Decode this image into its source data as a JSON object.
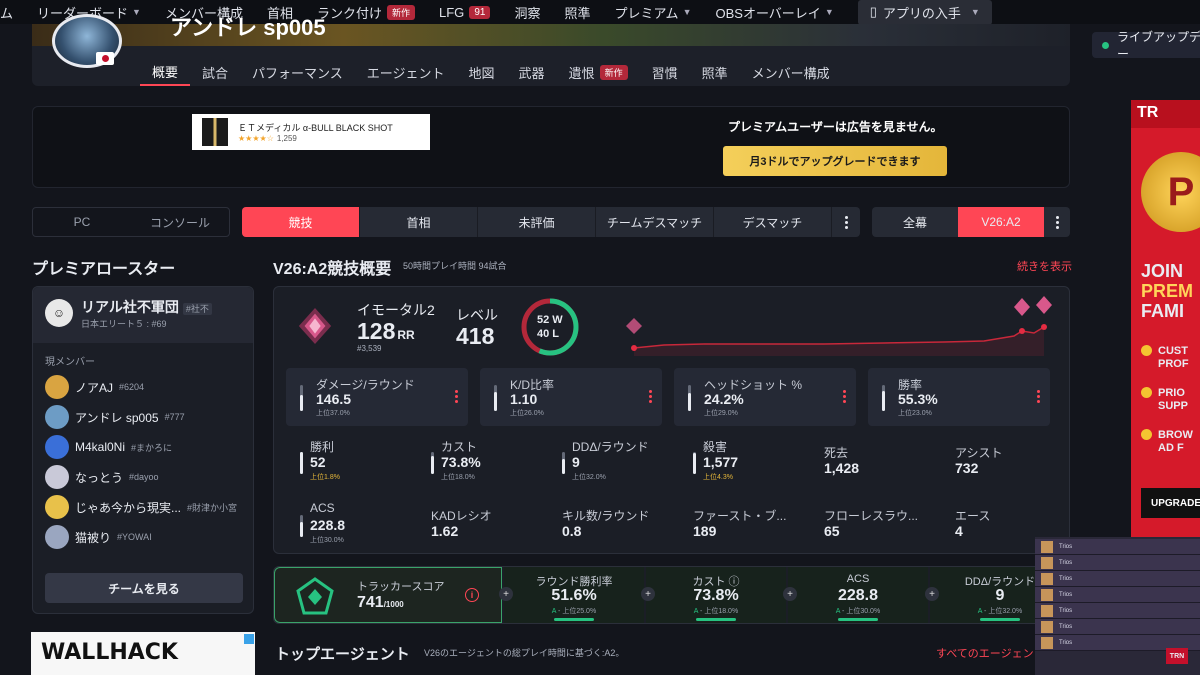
{
  "topnav": {
    "items": [
      {
        "label": "ム"
      },
      {
        "label": "リーダーボード",
        "chevron": true
      },
      {
        "label": "メンバー構成"
      },
      {
        "label": "首相"
      },
      {
        "label": "ランク付け",
        "badge": "新作"
      },
      {
        "label": "LFG",
        "count": "91"
      },
      {
        "label": "洞察"
      },
      {
        "label": "照準"
      },
      {
        "label": "プレミアム",
        "chevron": true
      },
      {
        "label": "OBSオーバーレイ"
      }
    ],
    "app_button": "アプリの入手"
  },
  "profile": {
    "name": "アンドレ sp005",
    "tabs": [
      "概要",
      "試合",
      "パフォーマンス",
      "エージェント",
      "地図",
      "武器",
      "遺恨",
      "習慣",
      "照準",
      "メンバー構成"
    ],
    "tab_badge": "新作",
    "active_tab": "概要"
  },
  "live_pill": "ライブアップデー",
  "ads": {
    "product": "ＥＴメディカル α-BULL BLACK SHOT",
    "reviews": "1,259",
    "premium_text": "プレミアムユーザーは広告を見ません。",
    "upgrade_button": "月3ドルでアップグレードできます",
    "right_top": "TR",
    "right_coin": "P",
    "right_headline": [
      "JOIN",
      "PREM",
      "FAMI"
    ],
    "right_list": [
      "CUST",
      "PROF",
      "PRIO",
      "SUPP",
      "BROW",
      "AD F"
    ],
    "right_button": "UPGRADE",
    "wallhack": "WALLHACK"
  },
  "filters": {
    "platforms": [
      "PC",
      "コンソール"
    ],
    "modes": [
      "競技",
      "首相",
      "未評価",
      "チームデスマッチ",
      "デスマッチ"
    ],
    "active_mode": "競技",
    "acts": [
      "全幕",
      "V26:A2"
    ],
    "active_act": "V26:A2"
  },
  "roster": {
    "title": "プレミアロースター",
    "team_name": "リアル社不軍団",
    "team_tag": "#社不",
    "team_sub": "日本エリート５ : #69",
    "current_members_label": "現メンバー",
    "members": [
      {
        "name": "ノアAJ",
        "tag": "#6204",
        "color": "#d9a441"
      },
      {
        "name": "アンドレ sp005",
        "tag": "#777",
        "color": "#6d9cc5"
      },
      {
        "name": "M4kal0Ni",
        "tag": "#まかろに",
        "color": "#3a6fd8"
      },
      {
        "name": "なっとう",
        "tag": "#dayoo",
        "color": "#c9c9d8"
      },
      {
        "name": "じゃあ今から現実...",
        "tag": "#財津か小宮",
        "color": "#e8c14a"
      },
      {
        "name": "猫被り",
        "tag": "#YOWAI",
        "color": "#9aa6c0"
      }
    ],
    "view_team_button": "チームを見る"
  },
  "overview": {
    "title": "V26:A2競技概要",
    "subtitle": "50時間プレイ時間 94試合",
    "show_more": "続きを表示",
    "rank": {
      "name": "イモータル2",
      "rr": "128",
      "rr_unit": "RR",
      "position": "#3,539"
    },
    "level": {
      "label": "レベル",
      "value": "418"
    },
    "wins": "52 W",
    "losses": "40 L",
    "win_fraction": 0.565,
    "cards": [
      {
        "label": "ダメージ/ラウンド",
        "value": "146.5",
        "pct": "上位37.0%",
        "fill": 0.63
      },
      {
        "label": "K/D比率",
        "value": "1.10",
        "pct": "上位26.0%",
        "fill": 0.74
      },
      {
        "label": "ヘッドショット %",
        "value": "24.2%",
        "pct": "上位29.0%",
        "fill": 0.71
      },
      {
        "label": "勝率",
        "value": "55.3%",
        "pct": "上位23.0%",
        "fill": 0.77
      }
    ],
    "stats": [
      {
        "label": "勝利",
        "value": "52",
        "pct": "上位1.8%",
        "fill": 0.98,
        "highlight": true
      },
      {
        "label": "カスト",
        "value": "73.8%",
        "pct": "上位18.0%",
        "fill": 0.82
      },
      {
        "label": "DDΔ/ラウンド",
        "value": "9",
        "pct": "上位32.0%",
        "fill": 0.68
      },
      {
        "label": "殺害",
        "value": "1,577",
        "pct": "上位4.3%",
        "fill": 0.96,
        "highlight": true
      },
      {
        "label": "死去",
        "value": "1,428"
      },
      {
        "label": "アシスト",
        "value": "732"
      },
      {
        "label": "ACS",
        "value": "228.8",
        "pct": "上位30.0%",
        "fill": 0.7
      },
      {
        "label": "KADレシオ",
        "value": "1.62"
      },
      {
        "label": "キル数/ラウンド",
        "value": "0.8"
      },
      {
        "label": "ファースト・ブ...",
        "value": "189"
      },
      {
        "label": "フローレスラウ...",
        "value": "65"
      },
      {
        "label": "エース",
        "value": "4"
      }
    ]
  },
  "tracker": {
    "label": "トラッカースコア",
    "score": "741",
    "max": "/1000",
    "cells": [
      {
        "label": "ラウンド勝利率",
        "value": "51.6%",
        "grade": "A",
        "pct": "上位25.0%"
      },
      {
        "label": "カスト ⓘ",
        "value": "73.8%",
        "grade": "A",
        "pct": "上位18.0%"
      },
      {
        "label": "ACS",
        "value": "228.8",
        "grade": "A",
        "pct": "上位30.0%"
      },
      {
        "label": "DDΔ/ラウンド",
        "value": "9",
        "grade": "A",
        "pct": "上位32.0%"
      }
    ]
  },
  "top_agents": {
    "title": "トップエージェント",
    "subtitle": "V26のエージェントの総プレイ時間に基づく:A2。",
    "more": "すべてのエージェン"
  },
  "overlay": {
    "rows": [
      "Trios",
      "Trios",
      "Trios",
      "Trios",
      "Trios",
      "Trios",
      "Trios"
    ],
    "badge": "TRN"
  }
}
